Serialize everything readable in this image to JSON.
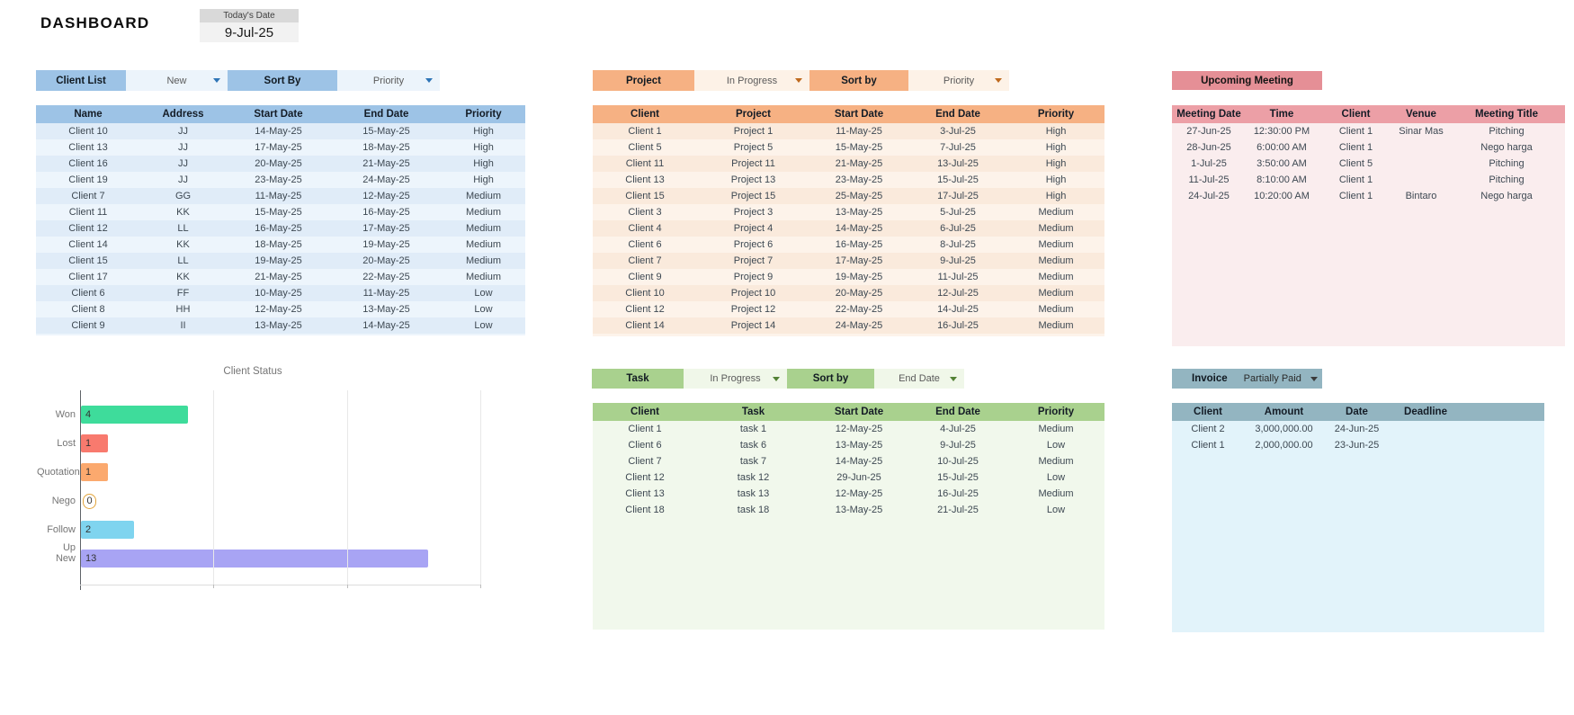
{
  "header": {
    "title": "DASHBOARD",
    "todays_date_label": "Today's Date",
    "todays_date_value": "9-Jul-25"
  },
  "client_list": {
    "title": "Client List",
    "filter_value": "New",
    "sort_label": "Sort By",
    "sort_value": "Priority",
    "columns": [
      "Name",
      "Address",
      "Start Date",
      "End Date",
      "Priority"
    ],
    "rows": [
      [
        "Client 10",
        "JJ",
        "14-May-25",
        "15-May-25",
        "High"
      ],
      [
        "Client 13",
        "JJ",
        "17-May-25",
        "18-May-25",
        "High"
      ],
      [
        "Client 16",
        "JJ",
        "20-May-25",
        "21-May-25",
        "High"
      ],
      [
        "Client 19",
        "JJ",
        "23-May-25",
        "24-May-25",
        "High"
      ],
      [
        "Client 7",
        "GG",
        "11-May-25",
        "12-May-25",
        "Medium"
      ],
      [
        "Client 11",
        "KK",
        "15-May-25",
        "16-May-25",
        "Medium"
      ],
      [
        "Client 12",
        "LL",
        "16-May-25",
        "17-May-25",
        "Medium"
      ],
      [
        "Client 14",
        "KK",
        "18-May-25",
        "19-May-25",
        "Medium"
      ],
      [
        "Client 15",
        "LL",
        "19-May-25",
        "20-May-25",
        "Medium"
      ],
      [
        "Client 17",
        "KK",
        "21-May-25",
        "22-May-25",
        "Medium"
      ],
      [
        "Client 6",
        "FF",
        "10-May-25",
        "11-May-25",
        "Low"
      ],
      [
        "Client 8",
        "HH",
        "12-May-25",
        "13-May-25",
        "Low"
      ],
      [
        "Client 9",
        "II",
        "13-May-25",
        "14-May-25",
        "Low"
      ]
    ]
  },
  "project": {
    "title": "Project",
    "filter_value": "In Progress",
    "sort_label": "Sort by",
    "sort_value": "Priority",
    "columns": [
      "Client",
      "Project",
      "Start Date",
      "End Date",
      "Priority"
    ],
    "rows": [
      [
        "Client 1",
        "Project 1",
        "11-May-25",
        "3-Jul-25",
        "High"
      ],
      [
        "Client 5",
        "Project 5",
        "15-May-25",
        "7-Jul-25",
        "High"
      ],
      [
        "Client 11",
        "Project 11",
        "21-May-25",
        "13-Jul-25",
        "High"
      ],
      [
        "Client 13",
        "Project 13",
        "23-May-25",
        "15-Jul-25",
        "High"
      ],
      [
        "Client 15",
        "Project 15",
        "25-May-25",
        "17-Jul-25",
        "High"
      ],
      [
        "Client 3",
        "Project 3",
        "13-May-25",
        "5-Jul-25",
        "Medium"
      ],
      [
        "Client 4",
        "Project 4",
        "14-May-25",
        "6-Jul-25",
        "Medium"
      ],
      [
        "Client 6",
        "Project 6",
        "16-May-25",
        "8-Jul-25",
        "Medium"
      ],
      [
        "Client 7",
        "Project 7",
        "17-May-25",
        "9-Jul-25",
        "Medium"
      ],
      [
        "Client 9",
        "Project 9",
        "19-May-25",
        "11-Jul-25",
        "Medium"
      ],
      [
        "Client 10",
        "Project 10",
        "20-May-25",
        "12-Jul-25",
        "Medium"
      ],
      [
        "Client 12",
        "Project 12",
        "22-May-25",
        "14-Jul-25",
        "Medium"
      ],
      [
        "Client 14",
        "Project 14",
        "24-May-25",
        "16-Jul-25",
        "Medium"
      ]
    ]
  },
  "meeting": {
    "title": "Upcoming Meeting",
    "columns": [
      "Meeting Date",
      "Time",
      "Client",
      "Venue",
      "Meeting Title"
    ],
    "rows": [
      [
        "27-Jun-25",
        "12:30:00 PM",
        "Client 1",
        "Sinar Mas",
        "Pitching"
      ],
      [
        "28-Jun-25",
        "6:00:00 AM",
        "Client 1",
        "",
        "Nego harga"
      ],
      [
        "1-Jul-25",
        "3:50:00 AM",
        "Client 5",
        "",
        "Pitching"
      ],
      [
        "11-Jul-25",
        "8:10:00 AM",
        "Client 1",
        "",
        "Pitching"
      ],
      [
        "24-Jul-25",
        "10:20:00 AM",
        "Client 1",
        "Bintaro",
        "Nego harga"
      ]
    ]
  },
  "task": {
    "title": "Task",
    "filter_value": "In Progress",
    "sort_label": "Sort by",
    "sort_value": "End Date",
    "columns": [
      "Client",
      "Task",
      "Start Date",
      "End Date",
      "Priority"
    ],
    "rows": [
      [
        "Client 1",
        "task 1",
        "12-May-25",
        "4-Jul-25",
        "Medium"
      ],
      [
        "Client 6",
        "task 6",
        "13-May-25",
        "9-Jul-25",
        "Low"
      ],
      [
        "Client 7",
        "task 7",
        "14-May-25",
        "10-Jul-25",
        "Medium"
      ],
      [
        "Client 12",
        "task 12",
        "29-Jun-25",
        "15-Jul-25",
        "Low"
      ],
      [
        "Client 13",
        "task 13",
        "12-May-25",
        "16-Jul-25",
        "Medium"
      ],
      [
        "Client 18",
        "task 18",
        "13-May-25",
        "21-Jul-25",
        "Low"
      ]
    ]
  },
  "invoice": {
    "title": "Invoice",
    "filter_value": "Partially Paid",
    "columns": [
      "Client",
      "Amount",
      "Date",
      "Deadline",
      ""
    ],
    "rows": [
      [
        "Client 2",
        "3,000,000.00",
        "24-Jun-25",
        "",
        ""
      ],
      [
        "Client 1",
        "2,000,000.00",
        "23-Jun-25",
        "",
        ""
      ]
    ]
  },
  "chart_data": {
    "type": "bar",
    "orientation": "horizontal",
    "title": "Client Status",
    "categories": [
      "Won",
      "Lost",
      "Quotation",
      "Nego",
      "Follow Up",
      "New"
    ],
    "values": [
      4,
      1,
      1,
      0,
      2,
      13
    ],
    "bar_colors": [
      "#3edc9b",
      "#f87a6e",
      "#fba96e",
      "#e2a43b",
      "#7fd4ef",
      "#a8a4f4"
    ],
    "xlabel": "",
    "ylabel": "",
    "xlim": [
      0,
      15
    ],
    "gridlines": [
      5,
      10,
      15
    ],
    "legend": "none"
  },
  "colors": {
    "client_accent": "#9dc3e6",
    "project_accent": "#f6b183",
    "meeting_accent": "#e58f96",
    "task_accent": "#a9d18e",
    "invoice_accent": "#93b5c1"
  }
}
